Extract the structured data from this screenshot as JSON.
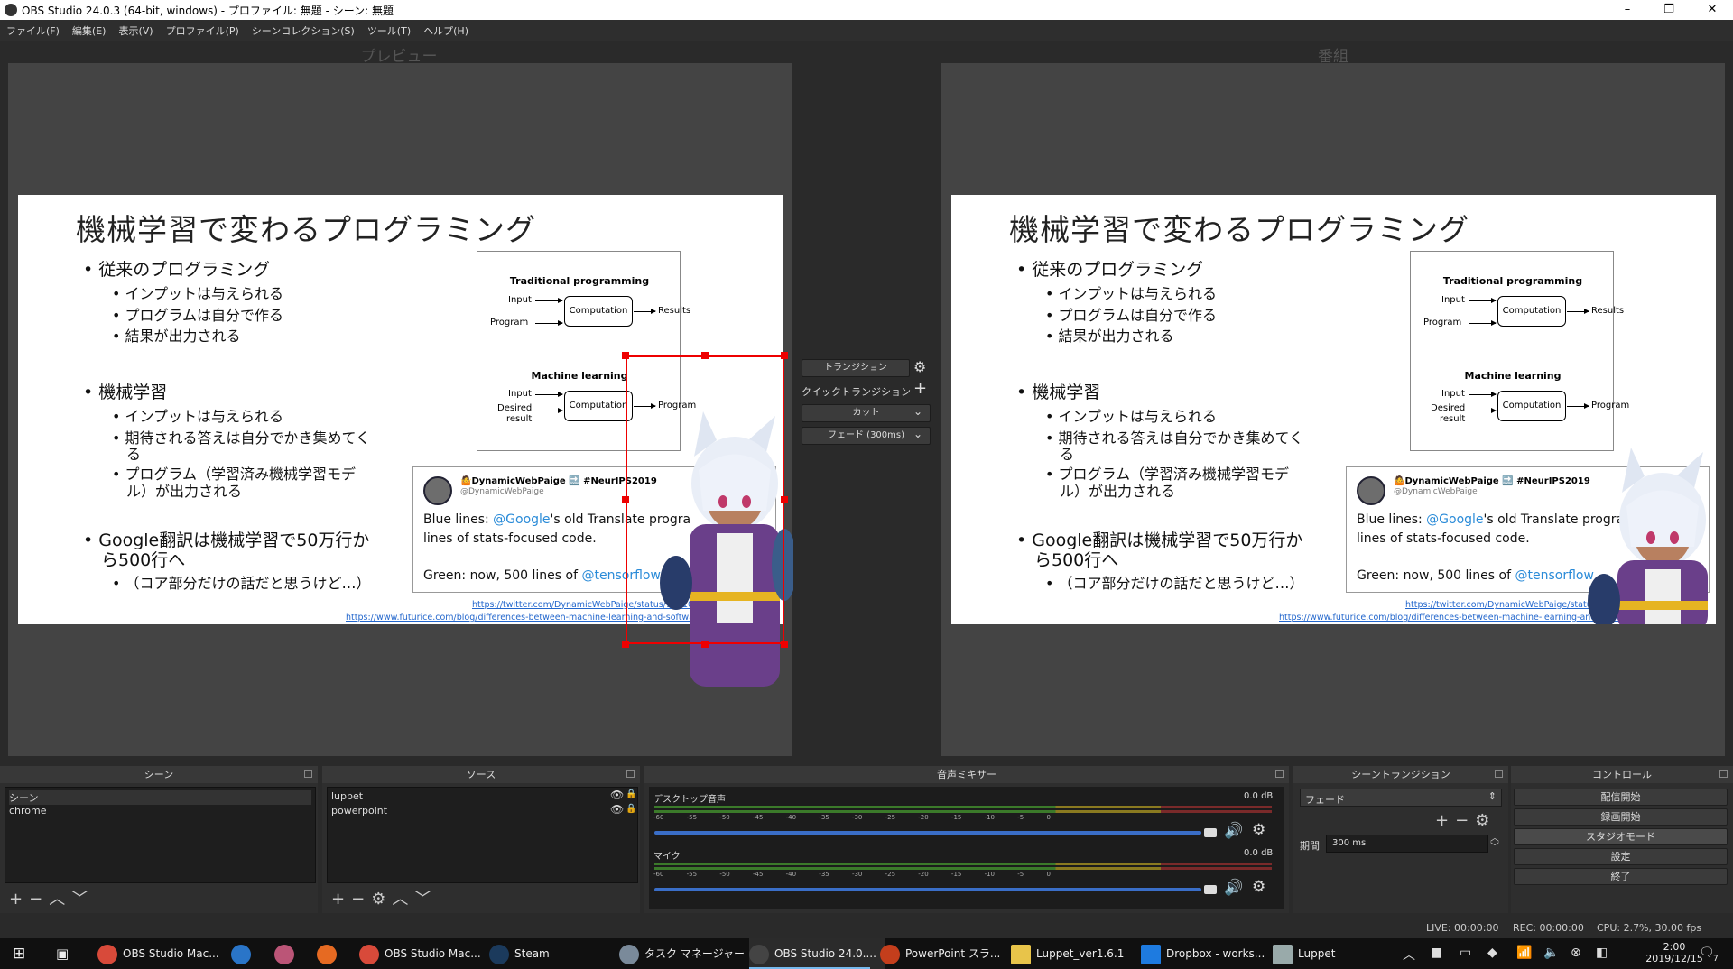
{
  "window": {
    "title": "OBS Studio 24.0.3 (64-bit, windows) - プロファイル: 無題 - シーン: 無題",
    "minimize": "–",
    "maximize": "❐",
    "close": "✕"
  },
  "menu": [
    "ファイル(F)",
    "編集(E)",
    "表示(V)",
    "プロファイル(P)",
    "シーンコレクション(S)",
    "ツール(T)",
    "ヘルプ(H)"
  ],
  "preview_label": "プレビュー",
  "program_label": "番組",
  "slide": {
    "title": "機械学習で変わるプログラミング",
    "bullets": [
      {
        "text": "従来のプログラミング",
        "sub": [
          "インプットは与えられる",
          "プログラムは自分で作る",
          "結果が出力される"
        ]
      },
      {
        "text": "機械学習",
        "sub": [
          "インプットは与えられる",
          "期待される答えは自分でかき集めてく",
          "る",
          "プログラム（学習済み機械学習モデ",
          "ル）が出力される"
        ]
      },
      {
        "text": "Google翻訳は機械学習で50万行か",
        "text2": "ら500行へ",
        "sub": [
          "（コア部分だけの話だと思うけど…）"
        ]
      }
    ],
    "diagram": {
      "trad_title": "Traditional programming",
      "input": "Input",
      "program": "Program",
      "computation": "Computation",
      "results": "Results",
      "ml_title": "Machine learning",
      "ml_input": "Input",
      "desired": "Desired",
      "result": "result",
      "ml_computation": "Computation",
      "ml_program": "Program"
    },
    "tweet": {
      "name": "🤷DynamicWebPaige 🔜 #NeurIPS2019",
      "handle": "@DynamicWebPaige",
      "line1a": "Blue lines: ",
      "m1": "@Google",
      "line1b": "'s old Translate progra",
      "line2": "lines of stats-focused code.",
      "line3a": "Green: now, 500 lines of ",
      "m2": "@tensorflow"
    },
    "link1": "https://twitter.com/DynamicWebPaige/status/1201061291109097",
    "link2": "https://www.futurice.com/blog/differences-between-machine-learning-and-software-engineering"
  },
  "transition": {
    "label": "トランジション",
    "quick": "クイックトランジション",
    "cut": "カット",
    "fade": "フェード (300ms)"
  },
  "scenes": {
    "header": "シーン",
    "items": [
      "シーン",
      "chrome"
    ]
  },
  "sources": {
    "header": "ソース",
    "items": [
      "luppet",
      "powerpoint"
    ]
  },
  "mixer": {
    "header": "音声ミキサー",
    "channels": [
      {
        "name": "デスクトップ音声",
        "db": "0.0 dB"
      },
      {
        "name": "マイク",
        "db": "0.0 dB"
      }
    ],
    "scale": "-60 -55 -50 -45 -40 -35 -30 -25 -20 -15 -10 -5 0"
  },
  "scene_transition": {
    "header": "シーントランジション",
    "value": "フェード",
    "duration_label": "期間",
    "duration": "300 ms"
  },
  "controls": {
    "header": "コントロール",
    "buttons": [
      "配信開始",
      "録画開始",
      "スタジオモード",
      "設定",
      "終了"
    ]
  },
  "status": {
    "live": "LIVE: 00:00:00",
    "rec": "REC: 00:00:00",
    "cpu": "CPU: 2.7%, 30.00 fps"
  },
  "taskbar": {
    "items": [
      "OBS Studio Mac...",
      "OBS Studio Mac...",
      "Steam",
      "タスク マネージャー",
      "OBS Studio 24.0....",
      "PowerPoint スラ...",
      "Luppet_ver1.6.1",
      "Dropbox - works...",
      "Luppet"
    ],
    "time": "2:00",
    "date": "2019/12/15",
    "notif": "7"
  },
  "colors": {
    "accent": "#e00000",
    "fader": "#3a6ec7",
    "link": "#2266cc"
  }
}
